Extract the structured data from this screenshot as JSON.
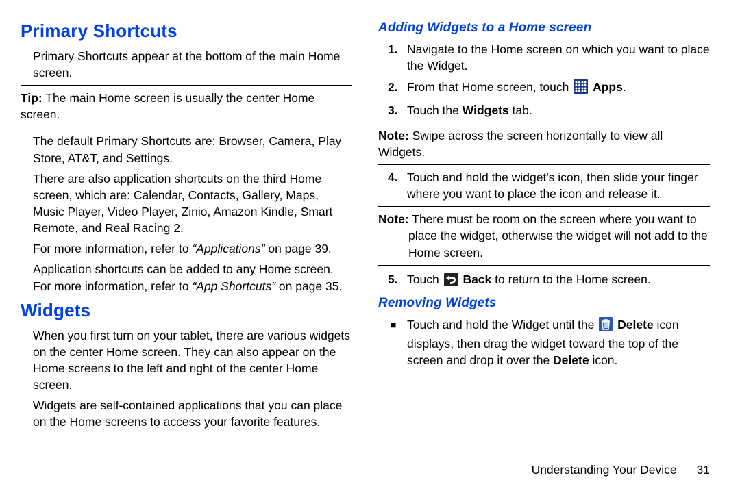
{
  "left": {
    "h_primary": "Primary Shortcuts",
    "p_primary_intro": "Primary Shortcuts appear at the bottom of the main Home screen.",
    "tip_label": "Tip:",
    "tip_text": " The main Home screen is usually the center Home screen.",
    "p_defaults": "The default Primary Shortcuts are: Browser, Camera, Play Store, AT&T, and Settings.",
    "p_also": "There are also application shortcuts on the third Home screen, which are: Calendar, Contacts, Gallery, Maps, Music Player, Video Player, Zinio, Amazon Kindle, Smart Remote, and Real Racing 2.",
    "p_moreinfo_pre": "For more information, refer to ",
    "p_moreinfo_link": "“Applications”",
    "p_moreinfo_post": "  on page 39.",
    "p_addshort_pre": "Application shortcuts can be added to any Home screen. For more information, refer to ",
    "p_addshort_link": "“App Shortcuts”",
    "p_addshort_post": "  on page 35.",
    "h_widgets": "Widgets",
    "p_widgets1": "When you first turn on your tablet, there are various widgets on the center Home screen. They can also appear on the Home screens to the left and right of the center Home screen.",
    "p_widgets2": "Widgets are self-contained applications that you can place on the Home screens to access your favorite features."
  },
  "right": {
    "h_adding": "Adding Widgets to a Home screen",
    "step1": "Navigate to the Home screen on which you want to place the Widget.",
    "step2_pre": "From that Home screen, touch ",
    "step2_post": " ",
    "step2_apps": "Apps",
    "step2_end": ".",
    "step3_pre": "Touch the ",
    "step3_b": "Widgets",
    "step3_post": " tab.",
    "note1_label": "Note:",
    "note1_text": " Swipe across the screen horizontally to view all Widgets.",
    "step4": "Touch and hold the widget's icon, then slide your finger where you want to place the icon and release it.",
    "note2_label": "Note:",
    "note2_text": " There must be room on the screen where you want to place the widget, otherwise the widget will not add to the Home screen.",
    "step5_pre": "Touch ",
    "step5_b": "Back",
    "step5_post": " to return to the Home screen.",
    "h_removing": "Removing Widgets",
    "rem_pre": "Touch and hold the Widget until the ",
    "rem_b1": "Delete",
    "rem_mid": " icon displays, then drag the widget toward the top of the screen and drop it over the ",
    "rem_b2": "Delete",
    "rem_post": " icon."
  },
  "footer": {
    "chapter": "Understanding Your Device",
    "page": "31"
  },
  "nums": {
    "n1": "1.",
    "n2": "2.",
    "n3": "3.",
    "n4": "4.",
    "n5": "5."
  },
  "bullet": "■"
}
